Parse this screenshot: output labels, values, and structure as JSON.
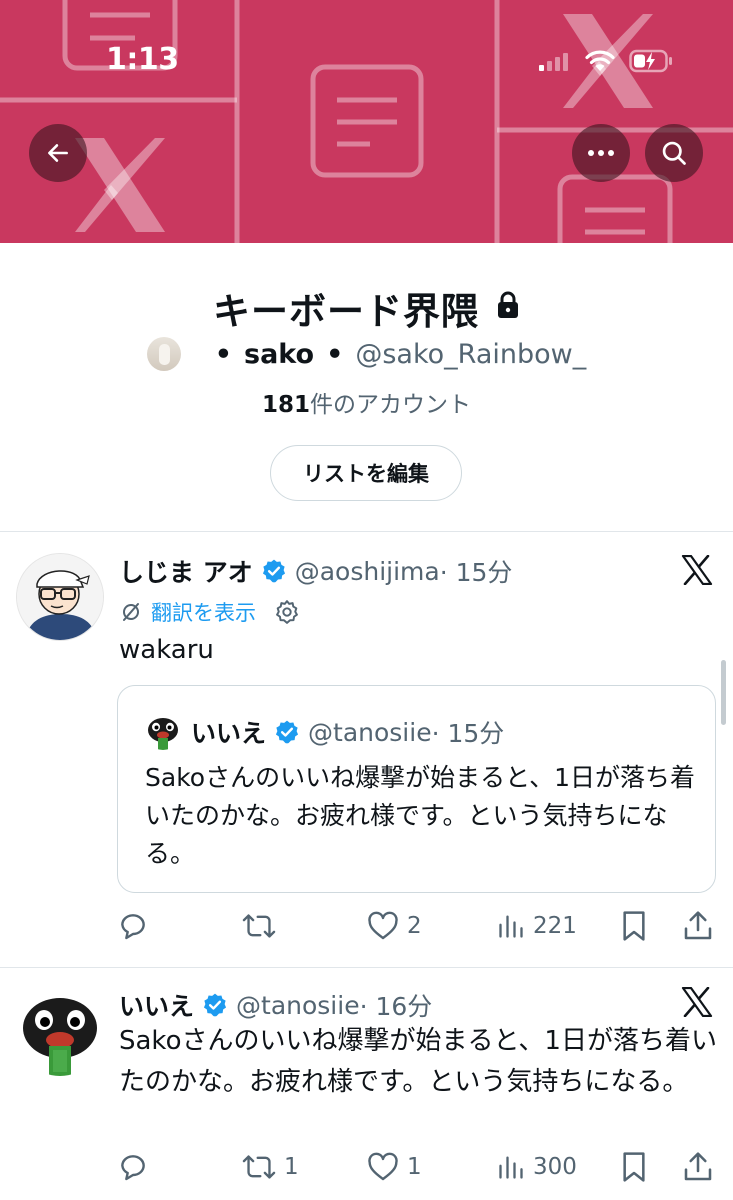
{
  "status_bar": {
    "time": "1:13"
  },
  "colors": {
    "banner": "#c9385f",
    "link": "#1d9bf0",
    "muted": "#536471",
    "verified": "#1d9bf0"
  },
  "icons": {
    "back": "arrow-left-icon",
    "more": "more-dots-icon",
    "search": "search-icon",
    "lock": "lock-icon",
    "verified": "verified-badge-icon",
    "x": "x-logo-icon",
    "translate": "translate-icon",
    "settings": "gear-icon",
    "reply": "reply-icon",
    "retweet": "retweet-icon",
    "like": "heart-icon",
    "views": "views-icon",
    "bookmark": "bookmark-icon",
    "share": "share-icon"
  },
  "list": {
    "title": "キーボード界隈",
    "owner_name": "sako",
    "owner_handle": "@sako_Rainbow_",
    "member_count_number": "181",
    "member_count_suffix": "件のアカウント",
    "edit_button": "リストを編集"
  },
  "tweets": [
    {
      "name": "しじま アオ",
      "handle": "@aoshijima",
      "time": "· 15分",
      "translate_label": "翻訳を表示",
      "text": "wakaru",
      "quote": {
        "name": "いいえ",
        "handle": "@tanosiie",
        "time": "· 15分",
        "text": "Sakoさんのいいね爆撃が始まると、1日が落ち着いたのかな。お疲れ様です。という気持ちになる。"
      },
      "actions": {
        "replies": "",
        "retweets": "",
        "likes": "2",
        "views": "221"
      }
    },
    {
      "name": "いいえ",
      "handle": "@tanosiie",
      "time": "· 16分",
      "text": "Sakoさんのいいね爆撃が始まると、1日が落ち着いたのかな。お疲れ様です。という気持ちになる。",
      "actions": {
        "replies": "",
        "retweets": "1",
        "likes": "1",
        "views": "300"
      }
    }
  ]
}
